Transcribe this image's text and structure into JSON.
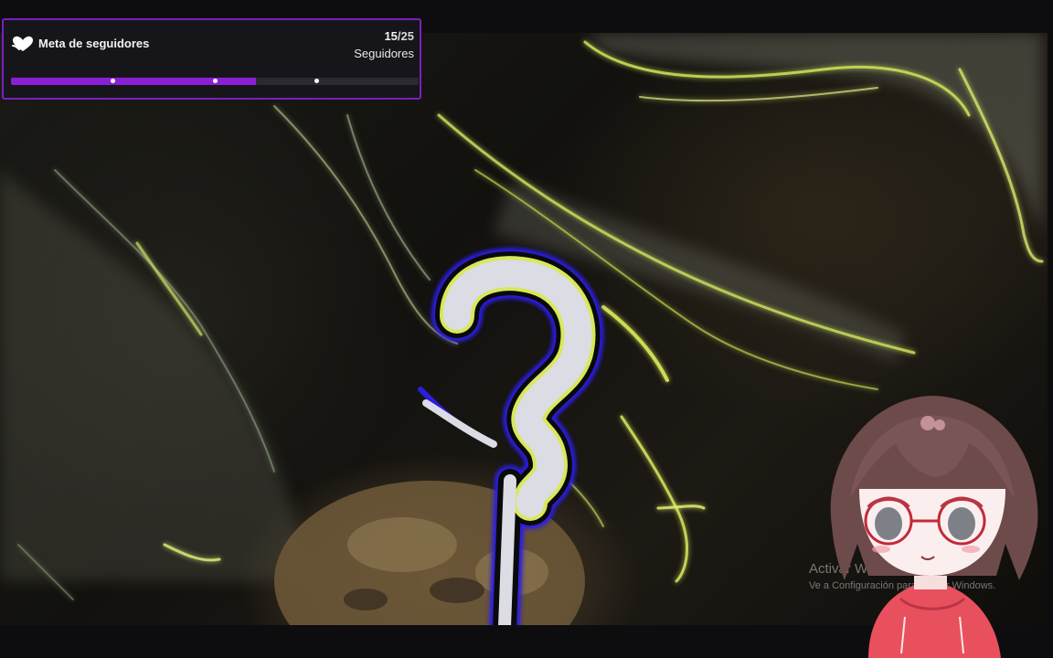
{
  "goal_widget": {
    "title": "Meta de seguidores",
    "current": "15",
    "separator": "/",
    "target": "25",
    "unit": "Seguidores",
    "progress_fraction": 0.6,
    "marker_fractions": [
      0.25,
      0.5,
      0.75
    ],
    "icon": "heart-hands-icon",
    "accent_color": "#8a1fd6",
    "border_color": "#7b1fbf"
  },
  "windows_watermark": {
    "title": "Activar Windows",
    "subtitle": "Ve a Configuración para activar Windows."
  },
  "colors": {
    "smoke_glow": "#d8e85a",
    "question_outline": "#2a1ee0",
    "avatar_hoodie": "#e8505e",
    "avatar_hair": "#6e4b4b"
  }
}
